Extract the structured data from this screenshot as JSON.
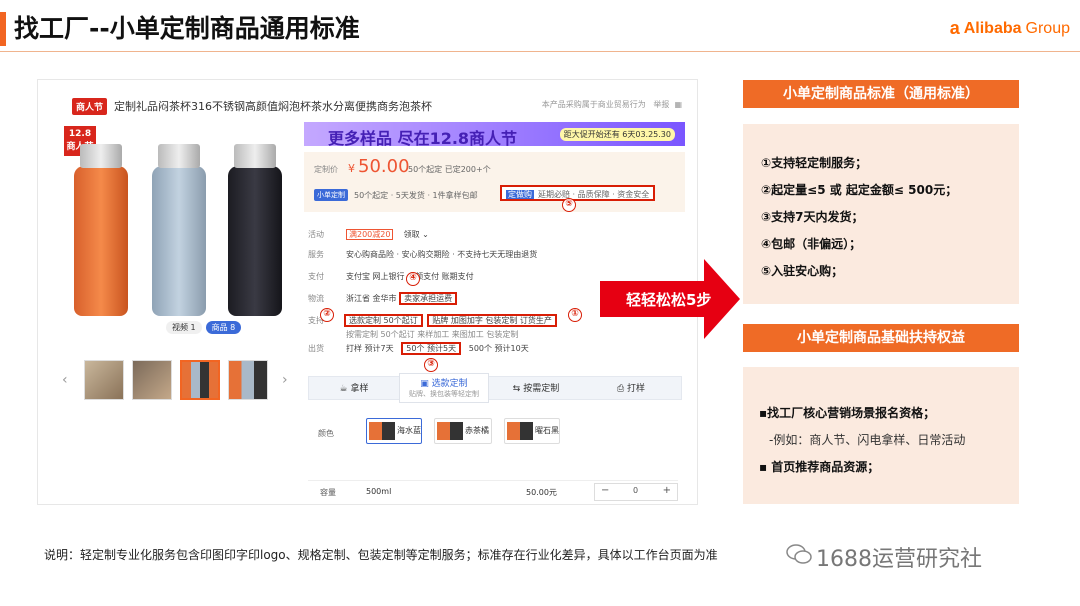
{
  "header": {
    "title": "找工厂--小单定制商品通用标准",
    "logo_mark": "a",
    "logo_brand": "Alibaba",
    "logo_group": "Group"
  },
  "product": {
    "tag": "商人节",
    "title": "定制礼品闷茶杯316不锈钢高颜值焖泡杯茶水分离便携商务泡茶杯",
    "top_right": "本产品采购属于商业贸易行为",
    "report": "举报",
    "badge_line1": "12.8",
    "badge_line2": "商人节",
    "video_btn": "视频 1",
    "goods_btn": "商品 8"
  },
  "promo": {
    "banner": "更多样品 尽在12.8商人节",
    "countdown": "距大促开始还有 6天03.25.30"
  },
  "price": {
    "label": "定制价",
    "currency": "¥",
    "value": "50.00",
    "moq": "50个起定  已定200+个",
    "tag": "小单定制",
    "desc": "50个起定 · 5天发货 · 1件拿样包邮",
    "assurance_tag": "定做购",
    "assurance": "延期必赔 · 品质保障 · 资金安全"
  },
  "rows": [
    {
      "k": "活动",
      "v": "领取 ⌄",
      "coupon": "满200减20"
    },
    {
      "k": "服务",
      "v": "安心购商品险 · 安心购交期险 · 不支持七天无理由退货"
    },
    {
      "k": "支付",
      "v": "支付宝   网上银行   大额支付   账期支付"
    },
    {
      "k": "物流",
      "v": "浙江省 金华市",
      "boxed": "卖家承担运费"
    },
    {
      "k": "支持",
      "v": "选款定制   50个起订",
      "boxed2": "贴牌   加图加字   包装定制   订货生产"
    },
    {
      "k": "",
      "v": "按需定制   50个起订     来样加工     来图加工     包装定制"
    },
    {
      "k": "出货",
      "v": "打样   预计7天",
      "boxed": "50个   预计5天",
      "tail": "500个   预计10天"
    }
  ],
  "tabs": [
    {
      "label": "拿样",
      "icon": "cup-icon"
    },
    {
      "label": "选款定制",
      "sub": "贴牌、换包装等轻定制",
      "icon": "grid-icon"
    },
    {
      "label": "按需定制",
      "icon": "swap-icon"
    },
    {
      "label": "打样",
      "icon": "print-icon"
    }
  ],
  "colors": {
    "label": "颜色",
    "options": [
      "海水蓝",
      "赤茶橘",
      "曜石黑"
    ]
  },
  "qty": {
    "label": "容量",
    "size": "500ml",
    "price": "50.00元",
    "minus": "−",
    "value": "0",
    "plus": "+"
  },
  "markers": [
    "①",
    "②",
    "③",
    "④",
    "⑤"
  ],
  "arrow_label": "轻轻松松5步",
  "standard": {
    "title": "小单定制商品标准（通用标准）",
    "items": [
      "①支持轻定制服务；",
      "②起定量≤5 或 起定金额≤ 500元；",
      "③支持7天内发货；",
      "④包邮（非偏远）；",
      "⑤入驻安心购；"
    ]
  },
  "benefits": {
    "title": "小单定制商品基础扶持权益",
    "items": [
      "▪找工厂核心营销场景报名资格；",
      "-例如：商人节、闪电拿样、日常活动",
      "▪ 首页推荐商品资源；"
    ]
  },
  "footnote": "说明：轻定制专业化服务包含印图印字印logo、规格定制、包装定制等定制服务；标准存在行业化差异，具体以工作台页面为准",
  "watermark": "1688运营研究社",
  "colors_theme": {
    "accent": "#ef6b26",
    "red": "#e60012",
    "panel": "#fbeadf"
  }
}
